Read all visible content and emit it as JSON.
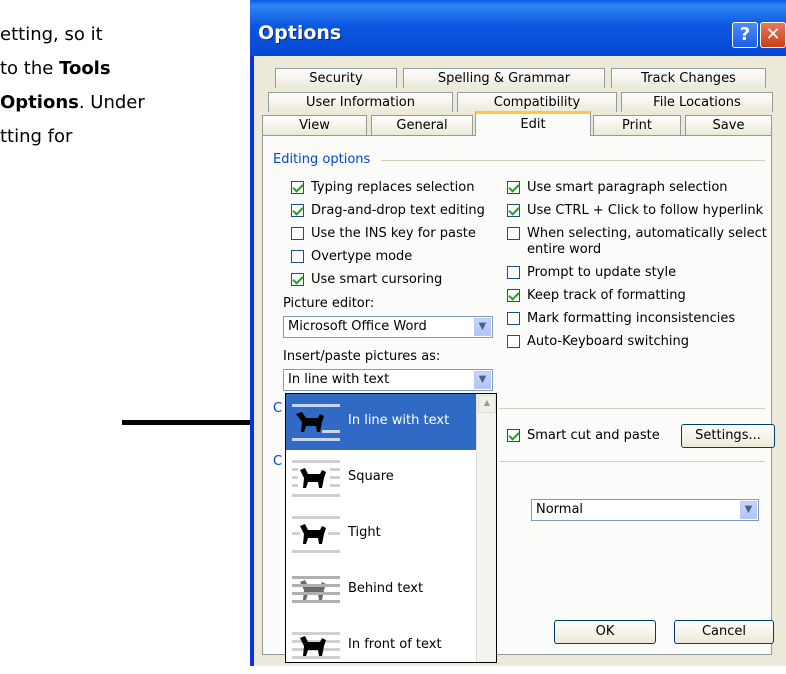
{
  "doc": {
    "line1": "etting, so it",
    "line2a": "to the ",
    "line2b": "Tools",
    "line3a": "Options",
    "line3b": ". Under",
    "line4": "tting for"
  },
  "window": {
    "title": "Options",
    "help_glyph": "?",
    "close_glyph": "✕"
  },
  "tabs": {
    "row1": [
      "Security",
      "Spelling & Grammar",
      "Track Changes"
    ],
    "row2": [
      "User Information",
      "Compatibility",
      "File Locations"
    ],
    "row3": [
      "View",
      "General",
      "Edit",
      "Print",
      "Save"
    ],
    "active": "Edit"
  },
  "editing": {
    "group_label": "Editing options",
    "left": [
      {
        "label": "Typing replaces selection",
        "checked": true
      },
      {
        "label": "Drag-and-drop text editing",
        "checked": true
      },
      {
        "label": "Use the INS key for paste",
        "checked": false
      },
      {
        "label": "Overtype mode",
        "checked": false
      },
      {
        "label": "Use smart cursoring",
        "checked": true
      }
    ],
    "right": [
      {
        "label": "Use smart paragraph selection",
        "checked": true
      },
      {
        "label": "Use CTRL + Click to follow hyperlink",
        "checked": true
      },
      {
        "label": "When selecting, automatically select",
        "label2": "entire word",
        "checked": false
      },
      {
        "label": "Prompt to update style",
        "checked": false
      },
      {
        "label": "Keep track of formatting",
        "checked": true
      },
      {
        "label": "Mark formatting inconsistencies",
        "checked": false
      },
      {
        "label": "Auto-Keyboard switching",
        "checked": false
      }
    ],
    "picture_editor_label": "Picture editor:",
    "picture_editor_value": "Microsoft Office Word",
    "insert_label": "Insert/paste pictures as:",
    "insert_value": "In line with text"
  },
  "cut": {
    "group_initial": "C",
    "smart_cut": {
      "label": "Smart cut and paste",
      "checked": true
    },
    "settings_button": "Settings..."
  },
  "click": {
    "group_initial": "C",
    "style_value": "Normal"
  },
  "dropdown": {
    "items": [
      "In line with text",
      "Square",
      "Tight",
      "Behind text",
      "In front of text"
    ],
    "selected": 0
  },
  "buttons": {
    "ok": "OK",
    "cancel": "Cancel"
  },
  "colors": {
    "title_blue": "#0a5fe8",
    "selection": "#316ac5",
    "group_label": "#0046d5",
    "active_tab_accent": "#ffc83c"
  }
}
